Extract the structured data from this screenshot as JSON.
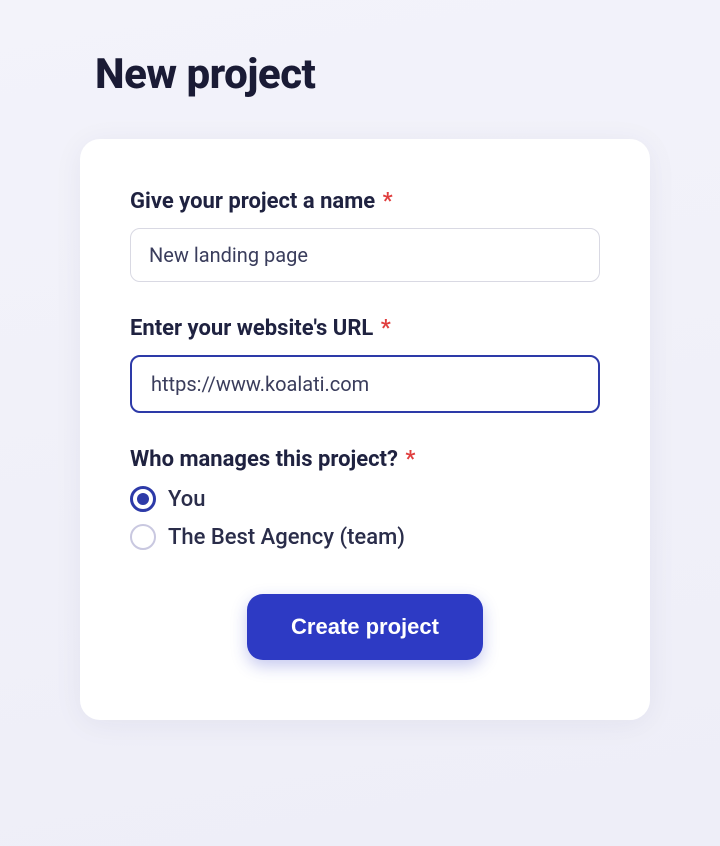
{
  "page": {
    "title": "New project"
  },
  "form": {
    "name": {
      "label": "Give your project a name",
      "value": "New landing page",
      "required": true
    },
    "url": {
      "label": "Enter your website's URL",
      "value": "https://www.koalati.com",
      "required": true
    },
    "manager": {
      "label": "Who manages this project?",
      "required": true,
      "options": [
        {
          "label": "You",
          "selected": true
        },
        {
          "label": "The Best Agency (team)",
          "selected": false
        }
      ]
    },
    "submit_label": "Create project"
  },
  "colors": {
    "accent": "#2d3ac4",
    "required": "#e03e3e"
  }
}
